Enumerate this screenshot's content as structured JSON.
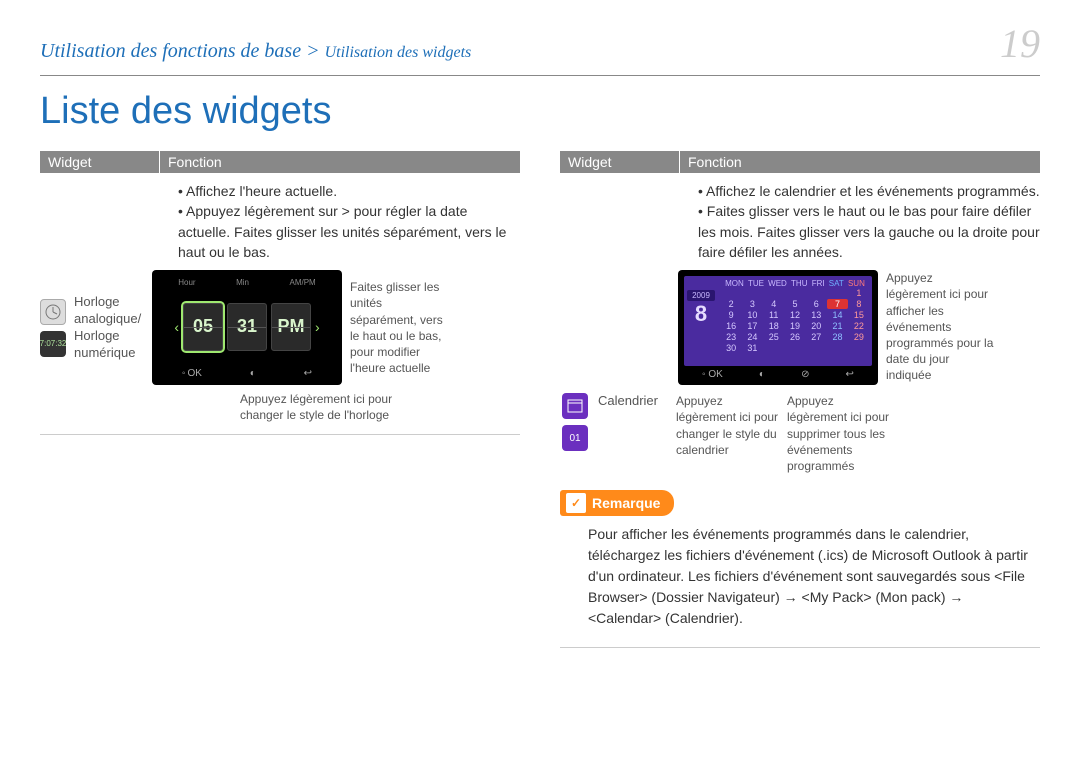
{
  "header": {
    "breadcrumb_main": "Utilisation des fonctions de base",
    "breadcrumb_sep": ">",
    "breadcrumb_sub": "Utilisation des widgets",
    "page_number": "19"
  },
  "title": "Liste des widgets",
  "table_headers": {
    "col1": "Widget",
    "col2": "Fonction"
  },
  "clock": {
    "label": "Horloge analogique/ Horloge numérique",
    "bullets": [
      "Affichez l'heure actuelle.",
      "Appuyez légèrement sur > pour régler la date actuelle. Faites glisser les unités séparément, vers le haut ou le bas."
    ],
    "device": {
      "labels": {
        "hour": "Hour",
        "min": "Min",
        "ampm": "AM/PM"
      },
      "hour": "05",
      "min": "31",
      "ampm": "PM",
      "ok": "OK",
      "back": "↩"
    },
    "callout_right": "Faites glisser les unités séparément, vers le haut ou le bas, pour modifier l'heure actuelle",
    "callout_bottom": "Appuyez légèrement ici pour changer le style de l'horloge",
    "digit_icon_text": "7:07:32"
  },
  "calendar": {
    "label": "Calendrier",
    "bullets": [
      "Affichez le calendrier et les événements programmés.",
      "Faites glisser vers le haut ou le bas pour faire défiler les mois. Faites glisser vers la gauche ou la droite pour faire défiler les années."
    ],
    "device": {
      "year": "2009",
      "big_day": "8",
      "days": [
        "MON",
        "TUE",
        "WED",
        "THU",
        "FRI",
        "SAT",
        "SUN"
      ],
      "grid": [
        "",
        "",
        "",
        "",
        "",
        "",
        "1",
        "2",
        "3",
        "4",
        "5",
        "6",
        "7",
        "8",
        "9",
        "10",
        "11",
        "12",
        "13",
        "14",
        "15",
        "16",
        "17",
        "18",
        "19",
        "20",
        "21",
        "22",
        "23",
        "24",
        "25",
        "26",
        "27",
        "28",
        "29",
        "30",
        "31"
      ],
      "today_index": 12,
      "ok": "OK",
      "back": "↩"
    },
    "callout_right": "Appuyez légèrement ici pour afficher les événements programmés pour la date du jour indiquée",
    "callout_b1": "Appuyez légèrement ici pour changer le style du calendrier",
    "callout_b2": "Appuyez légèrement ici pour supprimer tous les événements programmés",
    "icon2_text": "01"
  },
  "remark": {
    "label": "Remarque",
    "body": "Pour afficher les événements programmés dans le calendrier, téléchargez les fichiers d'événement (.ics) de Microsoft Outlook à partir d'un ordinateur. Les fichiers d'événement sont sauvegardés sous <File Browser> (Dossier Navigateur) → <My Pack> (Mon pack) → <Calendar> (Calendrier)."
  }
}
